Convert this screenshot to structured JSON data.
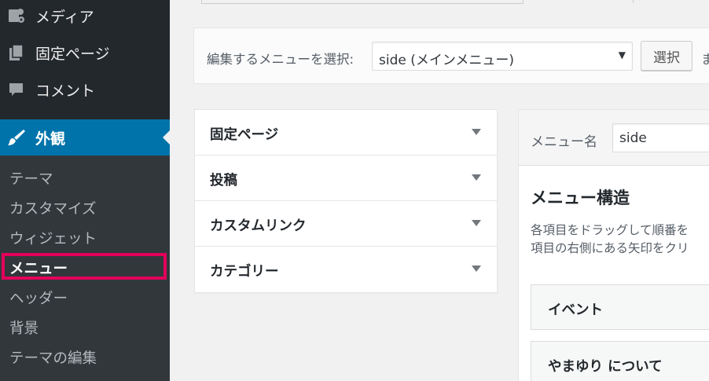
{
  "sidebar": {
    "media": "メディア",
    "pages": "固定ページ",
    "comments": "コメント",
    "appearance": "外観",
    "submenu": [
      "テーマ",
      "カスタマイズ",
      "ウィジェット",
      "メニュー",
      "ヘッダー",
      "背景",
      "テーマの編集"
    ]
  },
  "manage": {
    "label": "編集するメニューを選択:",
    "selected": "side (メインメニュー)",
    "button": "選択",
    "or": "ま"
  },
  "accordion": [
    "固定ページ",
    "投稿",
    "カスタムリンク",
    "カテゴリー"
  ],
  "menu": {
    "name_label": "メニュー名",
    "name_value": "side",
    "structure_title": "メニュー構造",
    "instr_1": "各項目をドラッグして順番を",
    "instr_2": "項目の右側にある矢印をクリ",
    "items": [
      "イベント",
      "やまゆり について"
    ]
  },
  "colors": {
    "sidebar_bg": "#23282d",
    "submenu_bg": "#32373c",
    "active_bg": "#0073aa",
    "highlight_border": "#e2005a"
  }
}
